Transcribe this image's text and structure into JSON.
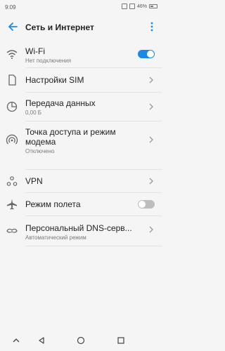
{
  "status_bar": {
    "time": "9:09",
    "battery": "46%"
  },
  "app_bar": {
    "title": "Сеть и Интернет"
  },
  "items": [
    {
      "label": "Wi-Fi",
      "sub": "Нет подключения",
      "control": "toggle",
      "toggle_on": true
    },
    {
      "label": "Настройки SIM",
      "sub": "",
      "control": "chevron"
    },
    {
      "label": "Передача данных",
      "sub": "0,00 Б",
      "control": "chevron"
    },
    {
      "label": "Точка доступа и режим модема",
      "sub": "Отключено",
      "control": "chevron"
    },
    {
      "label": "VPN",
      "sub": "",
      "control": "chevron"
    },
    {
      "label": "Режим полета",
      "sub": "",
      "control": "toggle",
      "toggle_on": false
    },
    {
      "label": "Персональный DNS-серв...",
      "sub": "Автоматический режим",
      "control": "chevron"
    }
  ],
  "colors": {
    "accent": "#1e88e5",
    "toggle_off": "#bdbdbd"
  }
}
